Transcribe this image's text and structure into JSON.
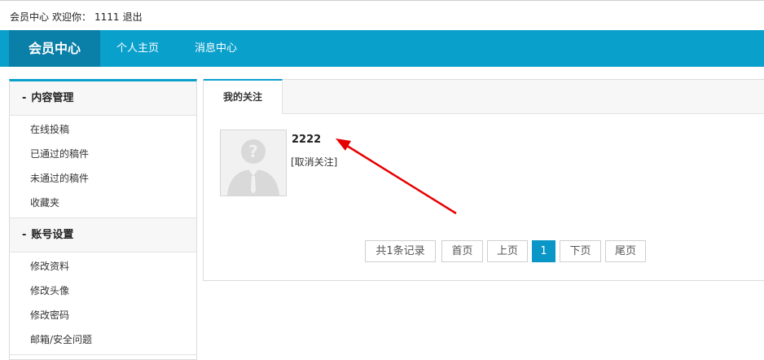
{
  "topbar": {
    "member_center": "会员中心",
    "welcome": "欢迎你：",
    "username": "1111",
    "logout": "退出"
  },
  "nav": {
    "brand": "会员中心",
    "links": [
      "个人主页",
      "消息中心"
    ]
  },
  "sidebar": {
    "groups": [
      {
        "title": "内容管理",
        "items": [
          "在线投稿",
          "已通过的稿件",
          "未通过的稿件",
          "收藏夹"
        ]
      },
      {
        "title": "账号设置",
        "items": [
          "修改资料",
          "修改头像",
          "修改密码",
          "邮箱/安全问题"
        ]
      }
    ]
  },
  "panel": {
    "tab": "我的关注",
    "follow": {
      "name": "2222",
      "action": "[取消关注]"
    }
  },
  "pagination": {
    "total": "共1条记录",
    "first": "首页",
    "prev": "上页",
    "current": "1",
    "next": "下页",
    "last": "尾页"
  },
  "colors": {
    "nav": "#0aa0cc",
    "brand": "#0a7fa8",
    "annotation_arrow": "#e60000"
  }
}
